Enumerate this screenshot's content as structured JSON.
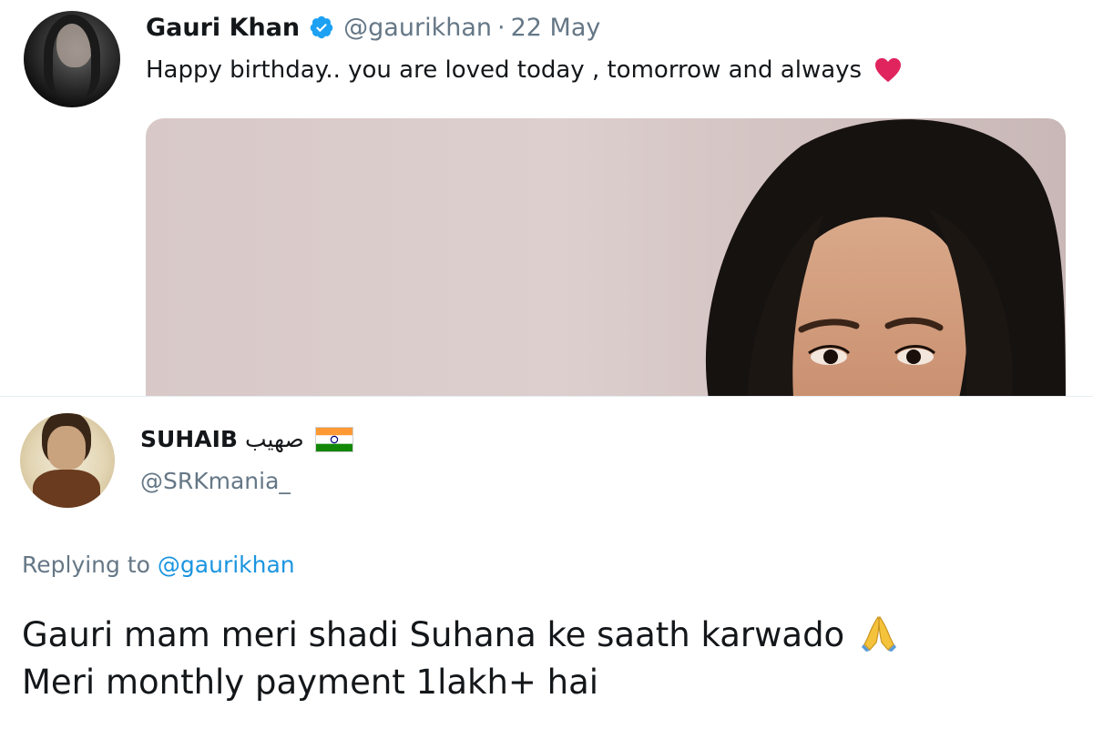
{
  "top_tweet": {
    "name": "Gauri Khan",
    "handle": "@gaurikhan",
    "separator": "·",
    "date": "22 May",
    "text": "Happy birthday.. you are loved today , tomorrow and always",
    "icons": [
      "verified-icon",
      "heart-icon"
    ],
    "accent_color": "#1da1f2",
    "heart_color": "#e0245e"
  },
  "reply_tweet": {
    "name": "SUHAIB",
    "name_arabic": "صهيب",
    "handle": "@SRKmania_",
    "replying_label": "Replying to",
    "replying_mention": "@gaurikhan",
    "line1": "Gauri mam meri shadi Suhana ke saath karwado",
    "line2": "Meri monthly payment 1lakh+ hai",
    "icons": [
      "india-flag-icon",
      "folded-hands-icon"
    ],
    "mention_color": "#1b95e0"
  }
}
